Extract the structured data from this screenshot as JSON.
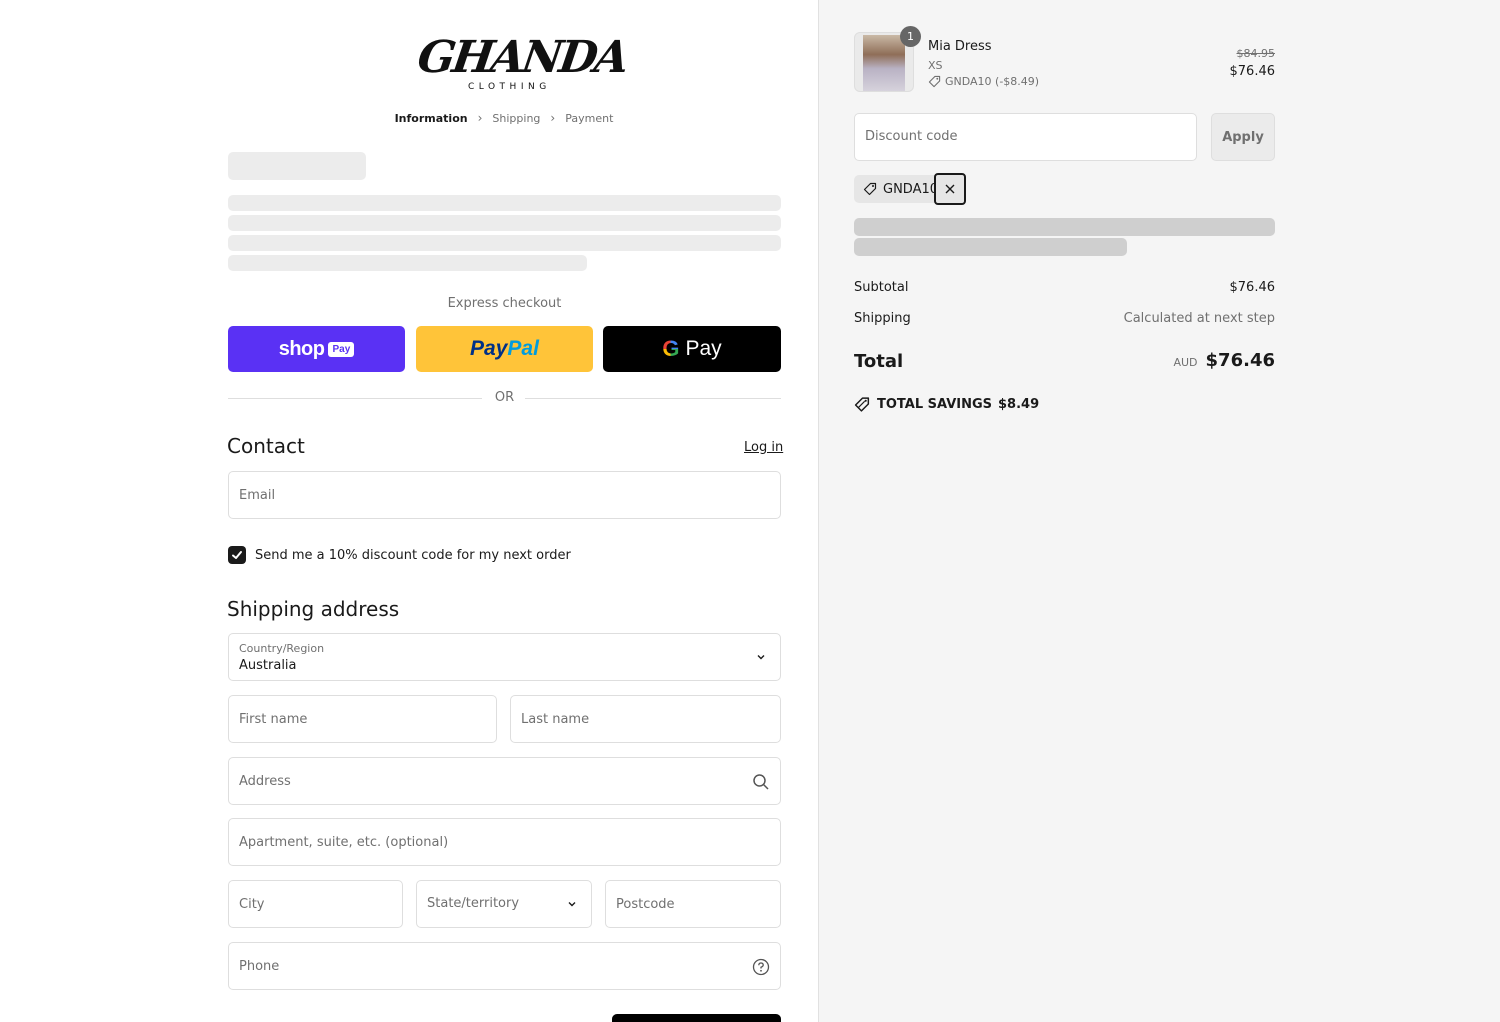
{
  "brand": {
    "logo_text": "GHANDA",
    "logo_subtext": "CLOTHING"
  },
  "breadcrumb": [
    {
      "label": "Information",
      "active": true
    },
    {
      "label": "Shipping",
      "active": false
    },
    {
      "label": "Payment",
      "active": false
    }
  ],
  "express": {
    "label": "Express checkout",
    "shop_pay": {
      "shop": "shop",
      "pay": "Pay"
    },
    "paypal": {
      "part1": "Pay",
      "part2": "Pal"
    },
    "gpay": {
      "g": "G",
      "pay": "Pay"
    },
    "or": "OR"
  },
  "contact": {
    "heading": "Contact",
    "login": "Log in",
    "email_placeholder": "Email",
    "newsletter_label": "Send me a 10% discount code for my next order",
    "newsletter_checked": true
  },
  "shipping_address": {
    "heading": "Shipping address",
    "country_label": "Country/Region",
    "country_value": "Australia",
    "first_name": "First name",
    "last_name": "Last name",
    "address": "Address",
    "apartment": "Apartment, suite, etc. (optional)",
    "city": "City",
    "state": "State/territory",
    "postcode": "Postcode",
    "phone": "Phone"
  },
  "order": {
    "item": {
      "quantity": "1",
      "name": "Mia Dress",
      "variant": "XS",
      "discount": "GNDA10 (-$8.49)",
      "original_price": "$84.95",
      "price": "$76.46"
    },
    "discount_placeholder": "Discount code",
    "apply_label": "Apply",
    "applied_code": "GNDA10",
    "subtotal_label": "Subtotal",
    "subtotal_value": "$76.46",
    "shipping_label": "Shipping",
    "shipping_value": "Calculated at next step",
    "total_label": "Total",
    "total_currency": "AUD",
    "total_value": "$76.46",
    "savings_label": "TOTAL SAVINGS",
    "savings_value": "$8.49"
  },
  "colors": {
    "shop_pay": "#5a31f4",
    "paypal": "#ffc439",
    "gpay": "#000000",
    "sidebar_bg": "#f5f5f5"
  }
}
